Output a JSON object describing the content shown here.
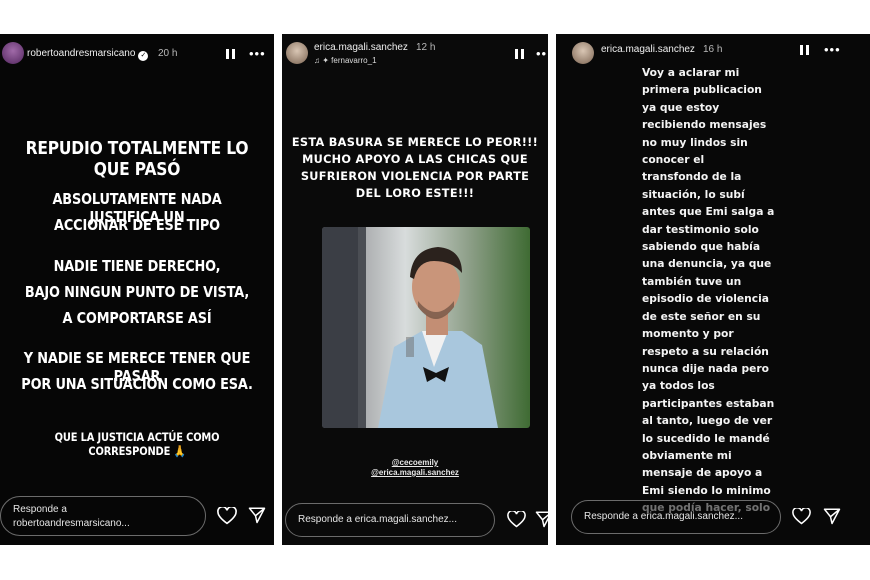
{
  "story1": {
    "username": "robertoandresmarsicano",
    "time": "20 h",
    "lines": [
      "REPUDIO TOTALMENTE LO QUE PASÓ",
      "ABSOLUTAMENTE NADA JUSTIFICA UN",
      "ACCIONAR DE ESE TIPO",
      "NADIE TIENE DERECHO,",
      "BAJO NINGUN PUNTO DE VISTA,",
      "A COMPORTARSE ASÍ",
      "Y NADIE SE MERECE TENER QUE PASAR",
      "POR UNA SITUACIÓN COMO ESA.",
      "QUE LA JUSTICIA ACTÚE COMO CORRESPONDE"
    ],
    "emoji": "🙏",
    "reply_line1": "Responde a",
    "reply_line2": "robertoandresmarsicano..."
  },
  "story2": {
    "username": "erica.magali.sanchez",
    "time": "12 h",
    "music": "fernavarro_1",
    "lines": [
      "ESTA BASURA SE MERECE LO PEOR!!!",
      "MUCHO APOYO A LAS CHICAS QUE",
      "SUFRIERON VIOLENCIA POR PARTE",
      "DEL LORO ESTE!!!"
    ],
    "tags": [
      "@cecoemily",
      "@erica.magali.sanchez"
    ],
    "reply": "Responde a erica.magali.sanchez..."
  },
  "story3": {
    "username": "erica.magali.sanchez",
    "time": "16 h",
    "lines": [
      "Voy a aclarar mi",
      "primera publicacion",
      "ya que estoy",
      "recibiendo mensajes",
      "no muy lindos sin",
      "conocer el",
      "transfondo de la",
      "situación, lo subí",
      "antes que Emi salga a",
      "dar testimonio solo",
      "sabiendo que había",
      "una denuncia, ya que",
      "también tuve un",
      "episodio de violencia",
      "de este señor en su",
      "momento y por",
      "respeto a su relación",
      "nunca dije nada pero",
      "ya todos los",
      "participantes estaban",
      "al tanto, luego de ver",
      "lo sucedido le mandé",
      "obviamente mi",
      "mensaje de apoyo a",
      "Emi siendo lo minimo",
      "que podía hacer, solo"
    ],
    "reply": "Responde a erica.magali.sanchez..."
  },
  "colors": {
    "background": "#060606",
    "text": "#ffffff",
    "reply_border": "#6b6b6b"
  }
}
